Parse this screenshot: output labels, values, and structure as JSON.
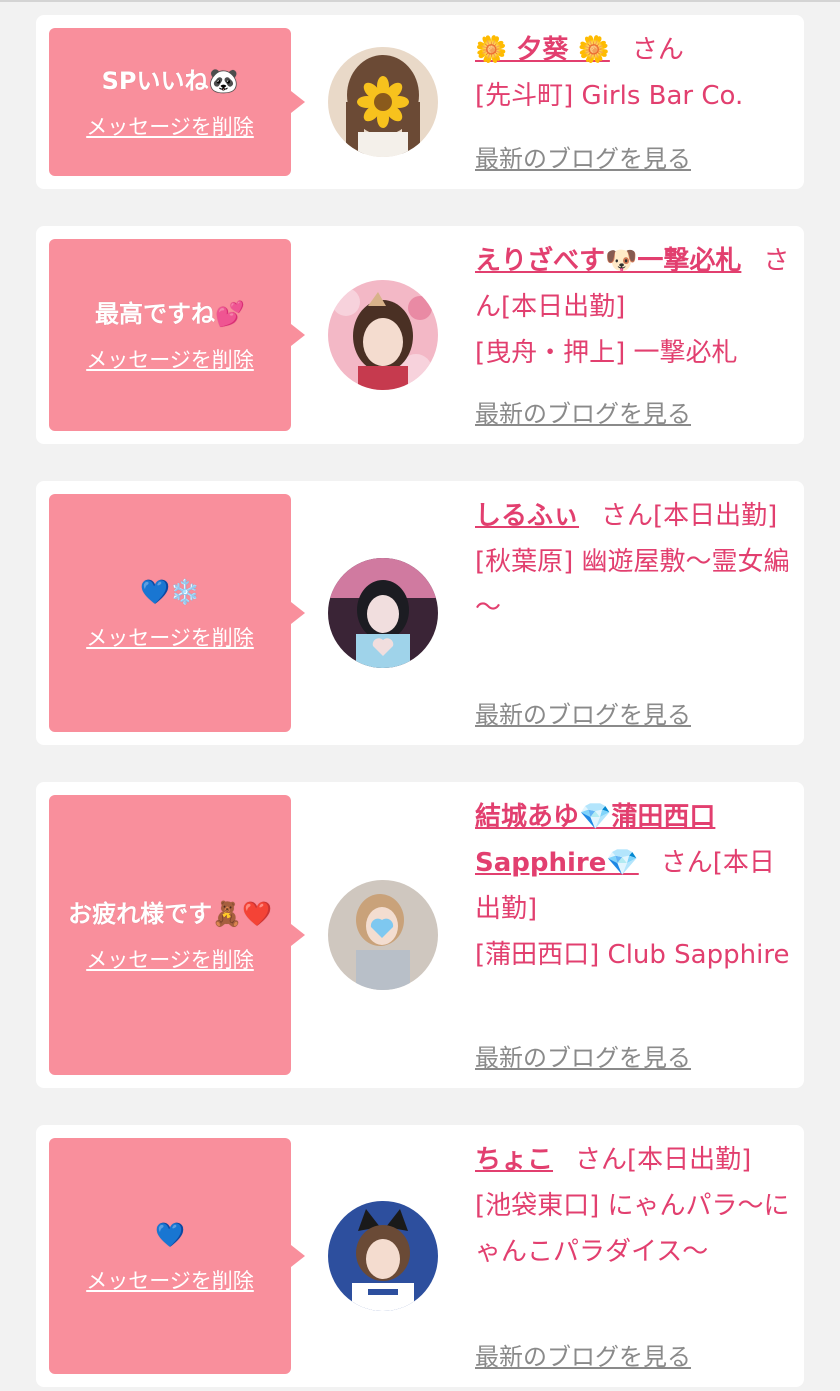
{
  "cards": [
    {
      "message": "SPいいね🐼",
      "delete_label": "メッセージを削除",
      "name": "🌼 夕葵 🌼",
      "honorific": "さん",
      "status": "",
      "shop": "[先斗町] Girls Bar Co.",
      "blog_label": "最新のブログを見る",
      "avatar_icon": "sunflower-face-cover"
    },
    {
      "message": "最高ですね💕",
      "delete_label": "メッセージを削除",
      "name": "えりざべす🐶一撃必札",
      "honorific": "さん",
      "status": "[本日出勤]",
      "shop": "[曳舟・押上] 一撃必札",
      "blog_label": "最新のブログを見る",
      "avatar_icon": "photo-floral"
    },
    {
      "message": "💙❄️",
      "delete_label": "メッセージを削除",
      "name": "しるふぃ",
      "honorific": "さん",
      "status": "[本日出勤]",
      "shop": "[秋葉原] 幽遊屋敷～霊女編～",
      "blog_label": "最新のブログを見る",
      "avatar_icon": "photo-heart-pose"
    },
    {
      "message": "お疲れ様です🧸❤️",
      "delete_label": "メッセージを削除",
      "name": "結城あゆ💎蒲田西口Sapphire💎",
      "honorific": "さん",
      "status": "[本日出勤]",
      "shop": "[蒲田西口] Club Sapphire",
      "blog_label": "最新のブログを見る",
      "avatar_icon": "photo-heart-cover"
    },
    {
      "message": "💙",
      "delete_label": "メッセージを削除",
      "name": "ちょこ",
      "honorific": "さん",
      "status": "[本日出勤]",
      "shop": "[池袋東口] にゃんパラ～にゃんこパラダイス～",
      "blog_label": "最新のブログを見る",
      "avatar_icon": "photo-cat-ears"
    }
  ],
  "colors": {
    "page_bg": "#f2f2f2",
    "card_bg": "#ffffff",
    "bubble": "#f98f9c",
    "accent_text": "#e23f6f",
    "muted_link": "#8a8a8a"
  }
}
